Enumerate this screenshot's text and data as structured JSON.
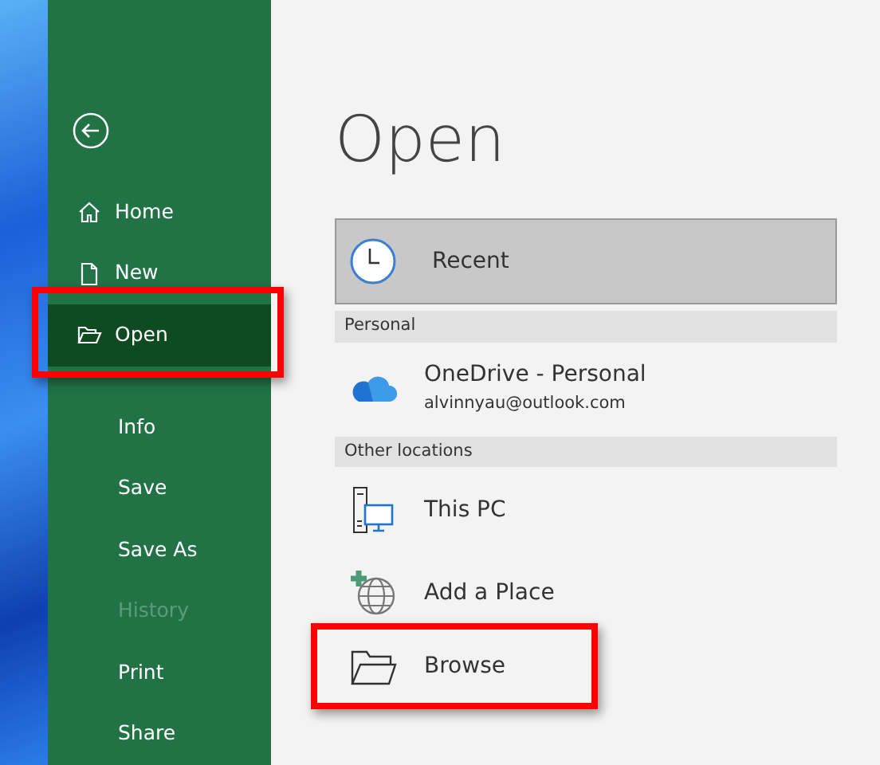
{
  "sidebar": {
    "primary": [
      {
        "label": "Home",
        "selected": false,
        "disabled": false
      },
      {
        "label": "New",
        "selected": false,
        "disabled": false
      },
      {
        "label": "Open",
        "selected": true,
        "disabled": false
      }
    ],
    "secondary": [
      {
        "label": "Info",
        "selected": false,
        "disabled": false
      },
      {
        "label": "Save",
        "selected": false,
        "disabled": false
      },
      {
        "label": "Save As",
        "selected": false,
        "disabled": false
      },
      {
        "label": "History",
        "selected": false,
        "disabled": true
      },
      {
        "label": "Print",
        "selected": false,
        "disabled": false
      },
      {
        "label": "Share",
        "selected": false,
        "disabled": false
      }
    ]
  },
  "title": "Open",
  "recent": {
    "label": "Recent",
    "selected": true
  },
  "sections": [
    {
      "heading": "Personal",
      "items": [
        {
          "label": "OneDrive - Personal",
          "detail": "alvinnyau@outlook.com",
          "selected": false
        }
      ]
    },
    {
      "heading": "Other locations",
      "items": [
        {
          "label": "This PC",
          "selected": false
        },
        {
          "label": "Add a Place",
          "selected": false
        },
        {
          "label": "Browse",
          "selected": false
        }
      ]
    }
  ]
}
